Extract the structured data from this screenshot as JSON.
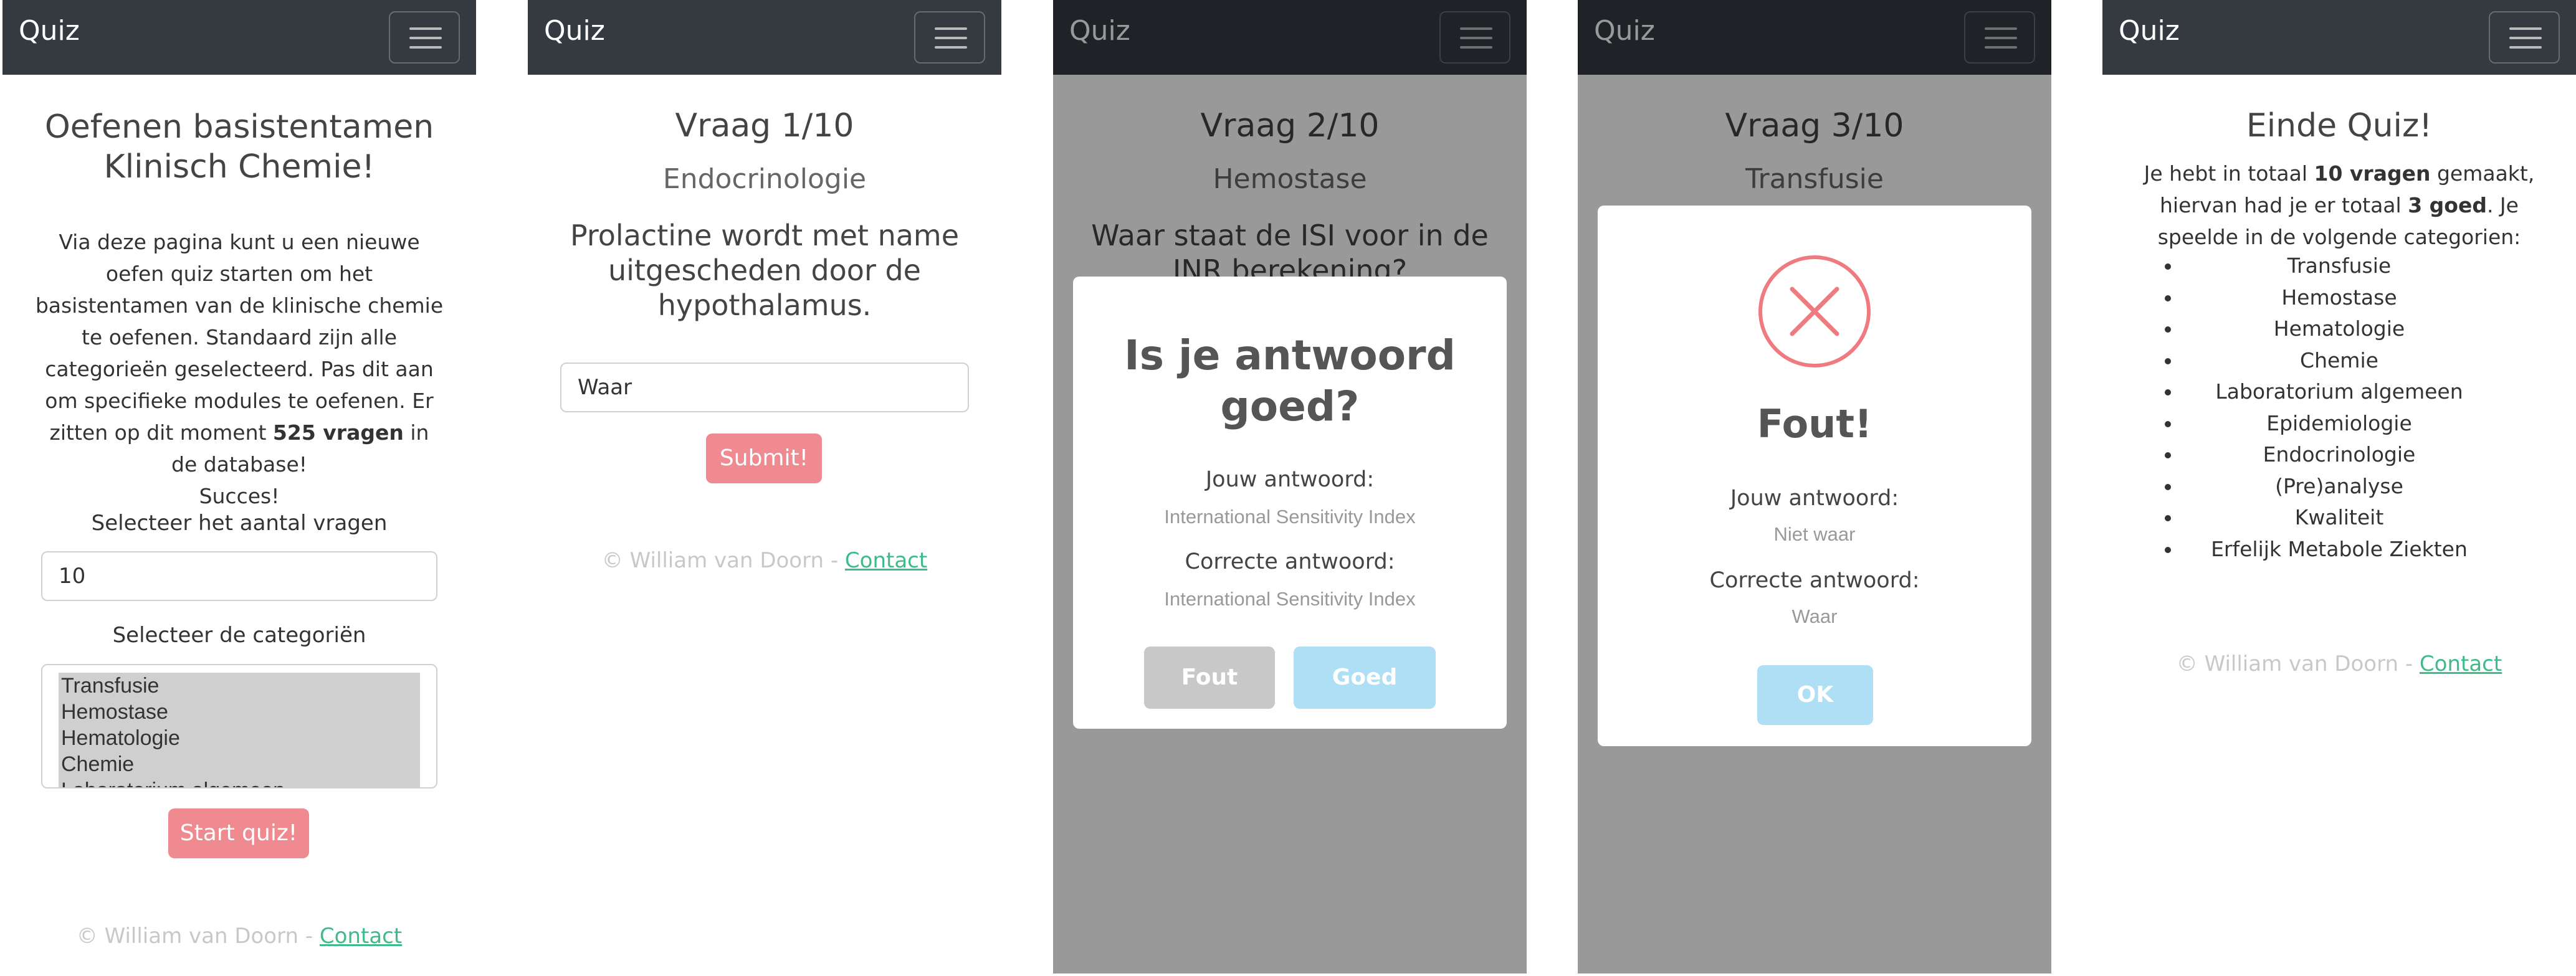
{
  "brand": "Quiz",
  "screen1": {
    "title": "Oefenen basistentamen Klinisch Chemie!",
    "intro_text": "Via deze pagina kunt u een nieuwe oefen quiz starten om het basistentamen van de klinische chemie te oefenen. Standaard zijn alle categorieën geselecteerd. Pas dit aan om specifieke modules te oefenen. Er zitten op dit moment",
    "question_count": "525 vragen",
    "intro_text_end": "in de database!",
    "success": "Succes!",
    "count_label": "Selecteer het aantal vragen",
    "count_value": "10",
    "category_label": "Selecteer de categoriën",
    "categories": [
      "Transfusie",
      "Hemostase",
      "Hematologie",
      "Chemie",
      "Laboratorium algemeen"
    ],
    "start_button": "Start quiz!"
  },
  "screen2": {
    "question_number": "Vraag 1/10",
    "category": "Endocrinologie",
    "question": "Prolactine wordt met name uitgescheden door de hypothalamus.",
    "answer_value": "Waar",
    "submit_button": "Submit!"
  },
  "screen3": {
    "question_number": "Vraag 2/10",
    "category": "Hemostase",
    "question": "Waar staat de ISI voor in de INR berekening?",
    "modal_title": "Is je antwoord goed?",
    "your_answer_label": "Jouw antwoord:",
    "your_answer": "International Sensitivity Index",
    "correct_answer_label": "Correcte antwoord:",
    "correct_answer": "International Sensitivity Index",
    "wrong_button": "Fout",
    "right_button": "Goed"
  },
  "screen4": {
    "question_number": "Vraag 3/10",
    "category": "Transfusie",
    "modal_title": "Fout!",
    "your_answer_label": "Jouw antwoord:",
    "your_answer": "Niet waar",
    "correct_answer_label": "Correcte antwoord:",
    "correct_answer": "Waar",
    "ok_button": "OK"
  },
  "screen5": {
    "title": "Einde Quiz!",
    "summary_pre": "Je hebt in totaal",
    "total_made": "10 vragen",
    "summary_mid": "gemaakt, hiervan had je er totaal",
    "total_correct": "3 goed",
    "summary_end": ". Je speelde in de volgende categorien:",
    "categories": [
      "Transfusie",
      "Hemostase",
      "Hematologie",
      "Chemie",
      "Laboratorium algemeen",
      "Epidemiologie",
      "Endocrinologie",
      "(Pre)analyse",
      "Kwaliteit",
      "Erfelijk Metabole Ziekten"
    ]
  },
  "footer": {
    "copyright": "© William van Doorn - ",
    "contact_link": "Contact"
  },
  "colors": {
    "navbar": "#343a40",
    "accent_red": "#ef8a91",
    "accent_blue": "#aedff4",
    "link_green": "#3fba8a",
    "error_red": "#ef7a7f"
  }
}
